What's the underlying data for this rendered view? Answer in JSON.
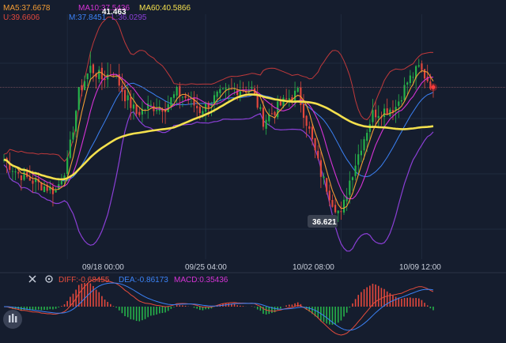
{
  "colors": {
    "background": "#151d2e",
    "bull": "#26b34a",
    "bear": "#e2483d",
    "ma5": "#f39c34",
    "ma10": "#d633d6",
    "ma60": "#f4e04d",
    "boll_upper": "#c0393b",
    "boll_mid": "#3b82f6",
    "boll_lower": "#8b3fd6",
    "diff": "#e74c3c",
    "dea": "#3b82f6",
    "macd_pos": "#e2483d",
    "macd_neg": "#26b34a",
    "text": "#c9cfdb"
  },
  "legend": {
    "ma5": "MA5:37.6678",
    "ma10": "MA10:37.5436",
    "ma60": "MA60:40.5866",
    "upper": "U:39.6606",
    "mid": "M:37.8451",
    "lower": "L:36.0295"
  },
  "macd_legend": {
    "diff": "DIFF:-0.68455",
    "dea": "DEA:-0.86173",
    "macd": "MACD:0.35436"
  },
  "icons": {
    "close": "close-icon",
    "settings": "gear-icon",
    "tool": "brush-icon"
  },
  "chart_data": {
    "type": "candlestick",
    "x_ticks": [
      "09/18 00:00",
      "09/25 04:00",
      "10/02 08:00",
      "10/09 12:00"
    ],
    "annotations": {
      "high": "41.463",
      "low": "36.621"
    },
    "high_value": 41.463,
    "low_value": 36.621,
    "last_price": 40.45,
    "ylim": [
      35.7,
      42.3
    ],
    "candle_count": 150,
    "segments": [
      [
        0,
        38.4
      ],
      [
        5,
        38.0
      ],
      [
        12,
        37.7
      ],
      [
        18,
        37.5
      ],
      [
        22,
        38.3
      ],
      [
        26,
        40.3
      ],
      [
        30,
        41.0
      ],
      [
        34,
        40.7
      ],
      [
        38,
        40.9
      ],
      [
        42,
        40.2
      ],
      [
        46,
        39.7
      ],
      [
        50,
        39.9
      ],
      [
        56,
        39.9
      ],
      [
        60,
        40.3
      ],
      [
        64,
        40.1
      ],
      [
        68,
        39.8
      ],
      [
        74,
        40.2
      ],
      [
        80,
        40.4
      ],
      [
        86,
        40.4
      ],
      [
        90,
        39.5
      ],
      [
        94,
        39.8
      ],
      [
        98,
        40.1
      ],
      [
        102,
        40.3
      ],
      [
        106,
        39.2
      ],
      [
        110,
        38.0
      ],
      [
        114,
        37.2
      ],
      [
        117,
        36.8
      ],
      [
        120,
        37.8
      ],
      [
        124,
        38.8
      ],
      [
        128,
        39.7
      ],
      [
        132,
        39.8
      ],
      [
        136,
        39.9
      ],
      [
        140,
        40.6
      ],
      [
        144,
        41.0
      ],
      [
        149,
        40.45
      ]
    ]
  }
}
